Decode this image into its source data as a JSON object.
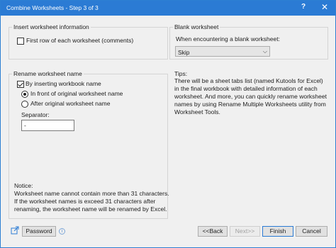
{
  "window": {
    "title": "Combine Worksheets - Step 3 of 3",
    "help_label": "?",
    "close_label": "✕"
  },
  "insert_group": {
    "title": "Insert worksheet information",
    "first_row_label": "First row of each worksheet (comments)",
    "first_row_checked": false
  },
  "blank_group": {
    "title": "Blank worksheet",
    "prompt": "When encountering a blank worksheet:",
    "selected": "Skip"
  },
  "rename_group": {
    "title": "Rename worksheet name",
    "insert_wb_label": "By inserting workbook name",
    "insert_wb_checked": true,
    "in_front_label": "In front of original worksheet name",
    "after_label": "After original worksheet name",
    "selected_position": "in_front",
    "separator_label": "Separator:",
    "separator_value": "-",
    "notice_title": "Notice:",
    "notice_line1": "Worksheet name cannot contain more than 31 characters.",
    "notice_line2": "If the worksheet names is exceed 31 characters after",
    "notice_line3": "renaming, the worksheet name will be renamed by Excel."
  },
  "tips": {
    "title": "Tips:",
    "text": "There will be a sheet tabs list (named Kutools for Excel) in the final workbook with detailed information of each worksheet. And more, you can quickly rename worksheet names by using Rename Multiple Worksheets utility from Worksheet Tools."
  },
  "footer": {
    "share_icon": "share-icon",
    "password_label": "Password",
    "info_icon_glyph": "i",
    "back_label": "<<Back",
    "next_label": "Next>>",
    "finish_label": "Finish",
    "cancel_label": "Cancel"
  }
}
